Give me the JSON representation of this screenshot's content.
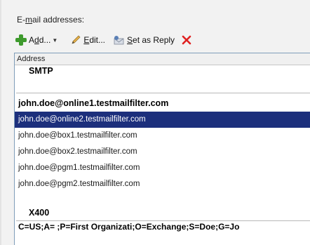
{
  "caption": {
    "prefix": "E-",
    "underline": "m",
    "rest": "ail addresses:"
  },
  "toolbar": {
    "add_label_pre": "A",
    "add_label_u": "d",
    "add_label_post": "d...",
    "edit_label_u": "E",
    "edit_label_post": "dit...",
    "reply_label_u": "S",
    "reply_label_post": "et as Reply"
  },
  "list": {
    "column_header": "Address",
    "groups": [
      {
        "name": "SMTP",
        "items": [
          {
            "address": "john.doe@online1.testmailfilter.com",
            "bold": true,
            "selected": false
          },
          {
            "address": "john.doe@online2.testmailfilter.com",
            "bold": false,
            "selected": true
          },
          {
            "address": "john.doe@box1.testmailfilter.com",
            "bold": false,
            "selected": false
          },
          {
            "address": "john.doe@box2.testmailfilter.com",
            "bold": false,
            "selected": false
          },
          {
            "address": "john.doe@pgm1.testmailfilter.com",
            "bold": false,
            "selected": false
          },
          {
            "address": "john.doe@pgm2.testmailfilter.com",
            "bold": false,
            "selected": false
          }
        ]
      },
      {
        "name": "X400",
        "items": [
          {
            "address": "C=US;A= ;P=First Organizati;O=Exchange;S=Doe;G=Jo",
            "bold": true,
            "selected": false
          }
        ]
      }
    ]
  },
  "colors": {
    "selection": "#1c2f7c",
    "add_icon": "#3e9a2d",
    "delete_icon": "#e02020"
  }
}
